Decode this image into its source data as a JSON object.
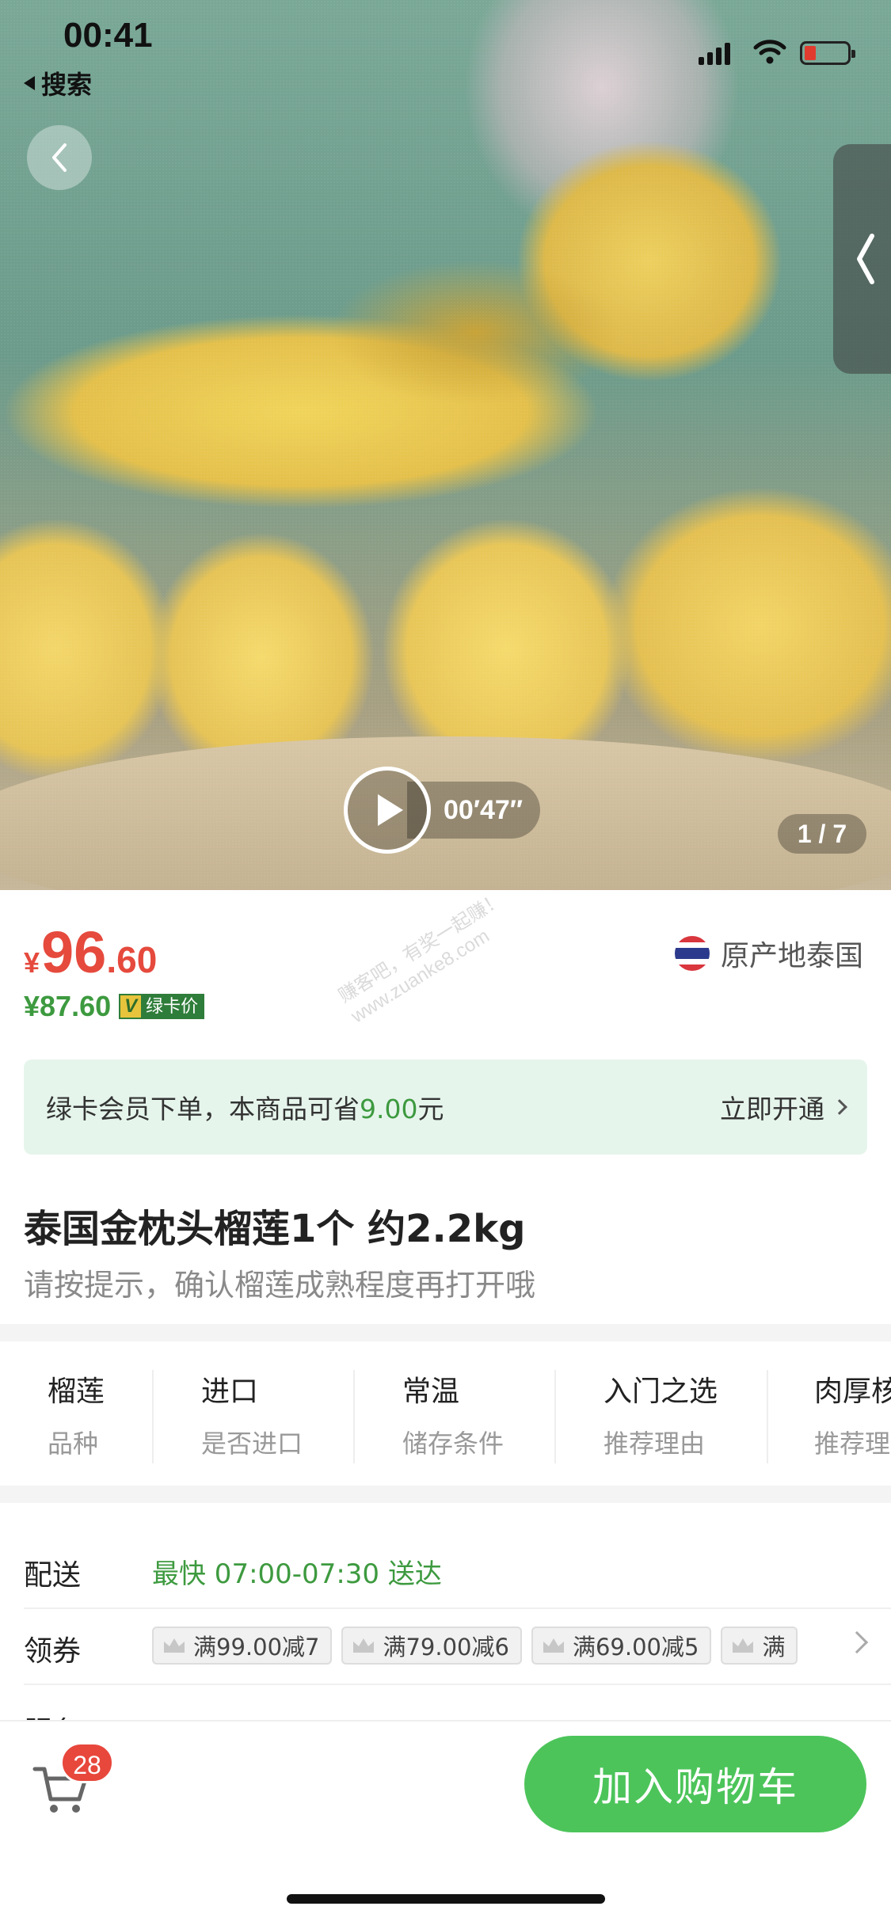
{
  "status_bar": {
    "time": "00:41",
    "back_app": "搜索"
  },
  "media": {
    "duration": "00′47″",
    "counter": "1 / 7"
  },
  "price": {
    "currency": "¥",
    "integer": "96",
    "decimal": ".60",
    "member_price": "¥87.60",
    "member_badge_v": "V",
    "member_badge_text": "绿卡价"
  },
  "origin": {
    "text": "原产地泰国"
  },
  "watermark": {
    "line1": "赚客吧，有奖一起赚！",
    "line2": "www.zuanke8.com"
  },
  "member_banner": {
    "prefix": "绿卡会员下单，本商品可省",
    "amount": "9.00",
    "suffix": "元",
    "cta": "立即开通"
  },
  "product": {
    "title": "泰国金枕头榴莲1个 约2.2kg",
    "subtitle": "请按提示，确认榴莲成熟程度再打开哦"
  },
  "specs": [
    {
      "value": "榴莲",
      "key": "品种"
    },
    {
      "value": "进口",
      "key": "是否进口"
    },
    {
      "value": "常温",
      "key": "储存条件"
    },
    {
      "value": "入门之选",
      "key": "推荐理由"
    },
    {
      "value": "肉厚核",
      "key": "推荐理"
    }
  ],
  "delivery": {
    "label": "配送",
    "value": "最快 07:00-07:30 送达"
  },
  "coupons": {
    "label": "领券",
    "items": [
      "满99.00减7",
      "满79.00减6",
      "满69.00减5",
      "满"
    ]
  },
  "service": {
    "label": "服务",
    "value": "····································"
  },
  "bottom_bar": {
    "cart_count": "28",
    "add_to_cart": "加入购物车"
  },
  "colors": {
    "price_red": "#e54a3d",
    "green": "#3d9a3f",
    "button_green": "#4cc45a",
    "banner_bg": "#e6f5ec"
  }
}
